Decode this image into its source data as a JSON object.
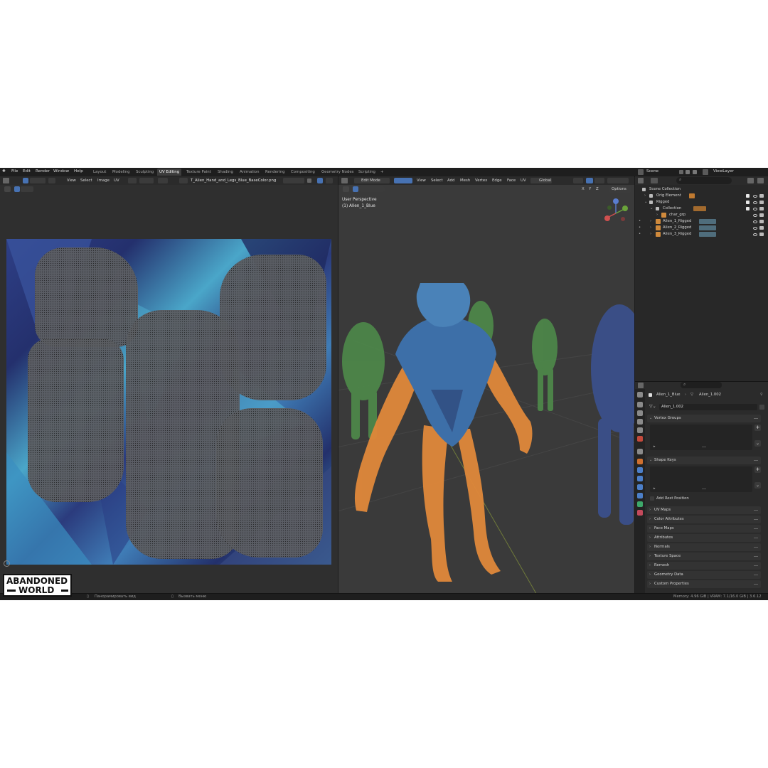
{
  "menu": {
    "items": [
      "File",
      "Edit",
      "Render",
      "Window",
      "Help"
    ]
  },
  "workspaces": {
    "tabs": [
      "Layout",
      "Modeling",
      "Sculpting",
      "UV Editing",
      "Texture Paint",
      "Shading",
      "Animation",
      "Rendering",
      "Compositing",
      "Geometry Nodes",
      "Scripting"
    ],
    "active": "UV Editing",
    "add": "+"
  },
  "scene": {
    "name": "Scene",
    "view_layer": "ViewLayer"
  },
  "uv_header": {
    "menus": [
      "View",
      "Select",
      "Image",
      "UV"
    ],
    "image_name": "T_Alien_Hand_and_Legs_Blue_BaseColor.png"
  },
  "viewport_header": {
    "mode": "Edit Mode",
    "menus": [
      "View",
      "Select",
      "Add",
      "Mesh",
      "Vertex",
      "Edge",
      "Face",
      "UV"
    ],
    "orientation": "Global",
    "options": "Options",
    "axis_labels": [
      "X",
      "Y",
      "Z"
    ]
  },
  "viewport_overlay": {
    "perspective": "User Perspective",
    "object": "(1) Alien_1_Blue"
  },
  "outliner": {
    "root": "Scene Collection",
    "items": [
      {
        "label": "Orig Element",
        "depth": 1
      },
      {
        "label": "Rigged",
        "depth": 1
      },
      {
        "label": "Collection",
        "depth": 2
      },
      {
        "label": "char_grp",
        "depth": 3
      },
      {
        "label": "Alien_1_Rigged",
        "depth": 2
      },
      {
        "label": "Alien_2_Rigged",
        "depth": 2
      },
      {
        "label": "Alien_3_Rigged",
        "depth": 2
      }
    ]
  },
  "properties": {
    "breadcrumb_object": "Alien_1_Blue",
    "breadcrumb_mesh": "Alien_1.002",
    "mesh_name": "Alien_1.002",
    "panels_open": [
      "Vertex Groups",
      "Shape Keys"
    ],
    "add_rest_position": "Add Rest Position",
    "panels_closed": [
      "UV Maps",
      "Color Attributes",
      "Face Maps",
      "Attributes",
      "Normals",
      "Texture Space",
      "Remesh",
      "Geometry Data",
      "Custom Properties"
    ]
  },
  "statusbar": {
    "pan": "Панорамировать вид",
    "menu": "Вызвать меню",
    "stats": "Memory: 4.96 GiB | VRAM: 7.1/16.0 GiB | 3.6.12"
  },
  "logo": {
    "line1": "ABANDONED",
    "line2": "WORLD"
  },
  "colors": {
    "accent": "#4772b3",
    "selected_mesh": "#e0883a",
    "uv_background": "#2f2f2f",
    "viewport_bg": "#3a3a3a"
  }
}
